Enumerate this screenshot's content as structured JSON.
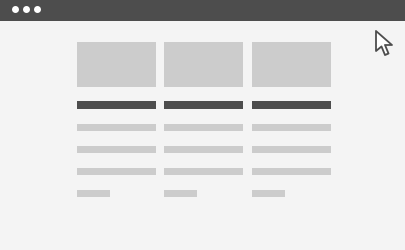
{
  "window": {
    "titlebar_color": "#4d4d4d",
    "dot_color": "#ffffff",
    "background_color": "#f4f4f4",
    "title_dots": [
      "dot",
      "dot",
      "dot"
    ]
  },
  "placeholders": {
    "thumbnail_color": "#cccccc",
    "heading_color": "#4d4d4d",
    "text_line_color": "#cccccc"
  },
  "cards": [
    {
      "id": "card-1"
    },
    {
      "id": "card-2"
    },
    {
      "id": "card-3"
    }
  ],
  "cursor": {
    "icon": "mouse-pointer-icon"
  }
}
